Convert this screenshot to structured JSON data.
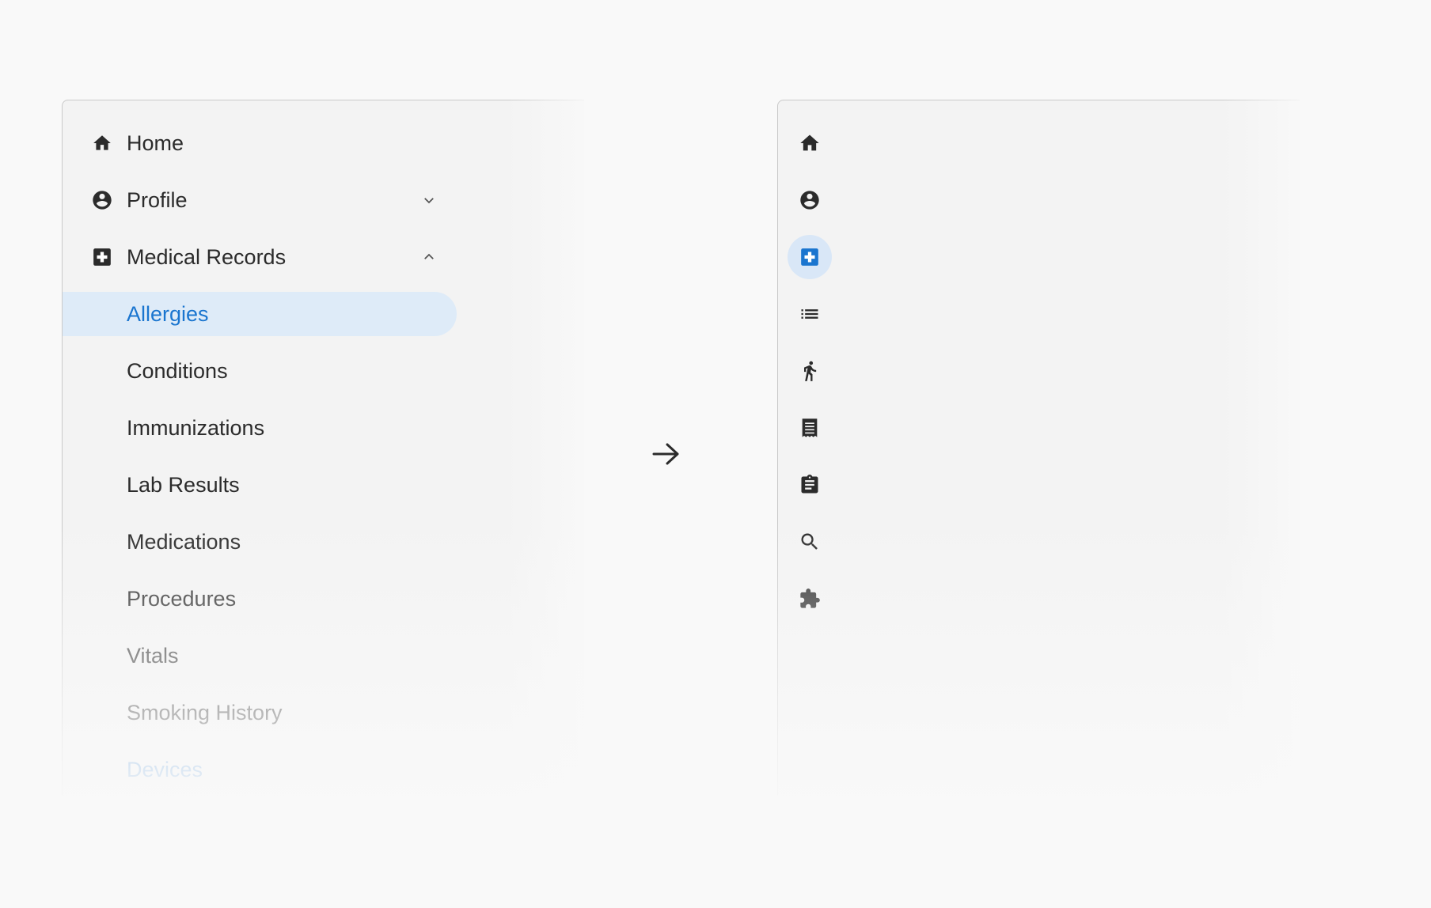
{
  "expanded_nav": {
    "items": [
      {
        "label": "Home",
        "icon": "home-icon"
      },
      {
        "label": "Profile",
        "icon": "account-circle-icon",
        "chevron": "chevron-down-icon"
      },
      {
        "label": "Medical Records",
        "icon": "medical-cross-icon",
        "chevron": "chevron-up-icon"
      },
      {
        "label": "Allergies",
        "selected": true
      },
      {
        "label": "Conditions"
      },
      {
        "label": "Immunizations"
      },
      {
        "label": "Lab Results"
      },
      {
        "label": "Medications"
      },
      {
        "label": "Procedures"
      },
      {
        "label": "Vitals"
      },
      {
        "label": "Smoking History"
      },
      {
        "label": "Devices"
      }
    ]
  },
  "collapsed_rail": {
    "items": [
      {
        "icon": "home-icon"
      },
      {
        "icon": "account-circle-icon"
      },
      {
        "icon": "medical-cross-icon",
        "selected": true
      },
      {
        "icon": "list-icon"
      },
      {
        "icon": "walking-person-icon"
      },
      {
        "icon": "receipt-icon"
      },
      {
        "icon": "clipboard-icon"
      },
      {
        "icon": "search-icon"
      },
      {
        "icon": "puzzle-icon"
      }
    ]
  },
  "arrow_icon": "arrow-right-icon",
  "colors": {
    "accent": "#1a75cf",
    "selected_bg": "#deebf8",
    "icon": "#2b2b2b",
    "text": "#2b2b2b"
  }
}
